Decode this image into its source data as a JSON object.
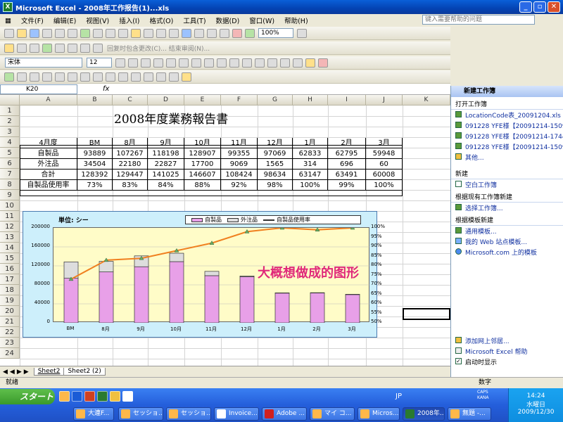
{
  "window": {
    "title": "Microsoft Excel - 2008年工作报告(1)...xls"
  },
  "menu": [
    "文件(F)",
    "编辑(E)",
    "视图(V)",
    "插入(I)",
    "格式(O)",
    "工具(T)",
    "数据(D)",
    "窗口(W)",
    "帮助(H)"
  ],
  "help_placeholder": "键入需要帮助的问题",
  "toolbar": {
    "zoom": "100%",
    "review_text": "回复时包含更改(C)... 结束审阅(N)...",
    "font": "宋体",
    "size": "12"
  },
  "name_box": "K20",
  "fx_label": "fx",
  "columns": [
    "A",
    "B",
    "C",
    "D",
    "E",
    "F",
    "G",
    "H",
    "I",
    "J",
    "K"
  ],
  "rows": [
    "1",
    "2",
    "3",
    "4",
    "5",
    "6",
    "7",
    "8",
    "9",
    "10",
    "11",
    "12",
    "13",
    "14",
    "15",
    "16",
    "17",
    "18",
    "19",
    "20",
    "21",
    "22",
    "23",
    "24"
  ],
  "sheet": {
    "title": "2008年度業務報告書",
    "header": [
      "4月度",
      "BM",
      "8月",
      "9月",
      "10月",
      "11月",
      "12月",
      "1月",
      "2月",
      "3月"
    ],
    "rows": [
      [
        "自製品",
        "93889",
        "107267",
        "118198",
        "128907",
        "99355",
        "97069",
        "62833",
        "62795",
        "59948"
      ],
      [
        "外注品",
        "34504",
        "22180",
        "22827",
        "17700",
        "9069",
        "1565",
        "314",
        "696",
        "60"
      ],
      [
        "合計",
        "128392",
        "129447",
        "141025",
        "146607",
        "108424",
        "98634",
        "63147",
        "63491",
        "60008"
      ],
      [
        "自製品使用率",
        "73%",
        "83%",
        "84%",
        "88%",
        "92%",
        "98%",
        "100%",
        "99%",
        "100%"
      ]
    ]
  },
  "chart_data": {
    "type": "bar",
    "unit_label": "単位: シー",
    "categories": [
      "BM",
      "8月",
      "9月",
      "10月",
      "11月",
      "12月",
      "1月",
      "2月",
      "3月"
    ],
    "series": [
      {
        "name": "自製品",
        "values": [
          93889,
          107267,
          118198,
          128907,
          99355,
          97069,
          62833,
          62795,
          59948
        ]
      },
      {
        "name": "外注品",
        "values": [
          34504,
          22180,
          22827,
          17700,
          9069,
          1565,
          314,
          696,
          60
        ]
      },
      {
        "name": "自製品使用率",
        "values": [
          73,
          83,
          84,
          88,
          92,
          98,
          100,
          99,
          100
        ]
      }
    ],
    "y_ticks": [
      "200000",
      "160000",
      "120000",
      "80000",
      "40000",
      "0"
    ],
    "y2_ticks": [
      "100%",
      "95%",
      "90%",
      "85%",
      "80%",
      "75%",
      "70%",
      "65%",
      "60%",
      "55%",
      "50%"
    ],
    "ylim": [
      0,
      200000
    ],
    "y2lim": [
      50,
      100
    ],
    "annotation": "大概想做成的图形",
    "colors": {
      "bar": "#e8a0e8",
      "outsource": "#dddddd",
      "line": "#f08020",
      "plot_bg": "#fffcc8"
    }
  },
  "sheet_tabs": [
    "Sheet2",
    "Sheet2 (2)"
  ],
  "status": {
    "left": "就绪",
    "right": "数字"
  },
  "taskpane": {
    "title": "新建工作簿",
    "open_section": "打开工作簿",
    "files": [
      "LocationCode表_20091204.xls",
      "091228 YFE様【20091214-1509",
      "091228 YFE様【20091214-1744",
      "091228 YFE様【20091214-1509"
    ],
    "more": "其他...",
    "new_section": "新建",
    "blank": "空白工作簿",
    "from_existing_section": "根据现有工作簿新建",
    "choose": "选择工作簿...",
    "template_section": "根据模板新建",
    "templates": [
      "通用模板...",
      "我的 Web 站点模板...",
      "Microsoft.com 上的模板"
    ],
    "bottom_links": [
      "添加网上邻居...",
      "Microsoft Excel 帮助"
    ],
    "startup": "启动时显示"
  },
  "taskbar": {
    "start": "スタート",
    "buttons": [
      "大連F...",
      "セッショ...",
      "セッショ...",
      "Invoice...",
      "Adobe ...",
      "マイ コ...",
      "Micros...",
      "2008年...",
      "無題 -..."
    ],
    "tray": {
      "time": "14:24",
      "day": "水曜日",
      "date": "2009/12/30",
      "ime": "JP",
      "caps": "CAPS KANA"
    }
  }
}
